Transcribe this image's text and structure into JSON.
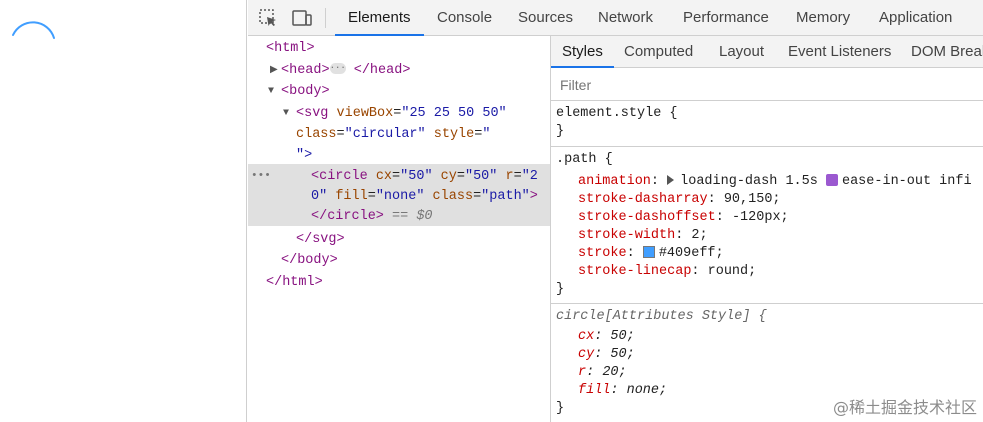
{
  "devtools": {
    "top_tabs": [
      "Elements",
      "Console",
      "Sources",
      "Network",
      "Performance",
      "Memory",
      "Application"
    ],
    "active_top_tab": "Elements",
    "sub_tabs": [
      "Styles",
      "Computed",
      "Layout",
      "Event Listeners",
      "DOM Breal"
    ],
    "active_sub_tab": "Styles",
    "filter_placeholder": "Filter"
  },
  "dom": {
    "html_open": "<html>",
    "head": "<head>",
    "head_close": "</head>",
    "body_open": "<body>",
    "svg_tag": "<svg",
    "svg_attr1_name": "viewBox",
    "svg_attr1_val": "\"25 25 50 50\"",
    "svg_attr2_name": "class",
    "svg_attr2_val": "\"circular\"",
    "svg_attr3_name": "style",
    "svg_attr3_val": "\"",
    "svg_close_quote": "\">",
    "circle_tag": "<circle",
    "circle_cx_name": "cx",
    "circle_cx_val": "\"50\"",
    "circle_cy_name": "cy",
    "circle_cy_val": "\"50\"",
    "circle_r_name": "r",
    "circle_r_val_a": "\"2",
    "circle_r_val_b": "0\"",
    "circle_fill_name": "fill",
    "circle_fill_val": "\"none\"",
    "circle_class_name": "class",
    "circle_class_val": "\"path\"",
    "circle_end": ">",
    "circle_close": "</circle>",
    "selected_marker": "== $0",
    "svg_close": "</svg>",
    "body_close": "</body>",
    "html_close": "</html>"
  },
  "styles": {
    "element_style_selector": "element.style {",
    "close_brace": "}",
    "path_selector": ".path {",
    "path_rules": [
      {
        "prop": "animation",
        "val": "loading-dash 1.5s",
        "extra": "ease-in-out infi"
      },
      {
        "prop": "stroke-dasharray",
        "val": "90,150;"
      },
      {
        "prop": "stroke-dashoffset",
        "val": "-120px;"
      },
      {
        "prop": "stroke-width",
        "val": "2;"
      },
      {
        "prop": "stroke",
        "val": "#409eff;"
      },
      {
        "prop": "stroke-linecap",
        "val": "round;"
      }
    ],
    "attr_selector": "circle[Attributes Style] {",
    "attr_rules": [
      {
        "prop": "cx",
        "val": "50;"
      },
      {
        "prop": "cy",
        "val": "50;"
      },
      {
        "prop": "r",
        "val": "20;"
      },
      {
        "prop": "fill",
        "val": "none;"
      }
    ]
  },
  "colors": {
    "spinner_stroke": "#409eff",
    "active_tab_underline": "#1a73e8"
  },
  "watermark": "@稀土掘金技术社区"
}
